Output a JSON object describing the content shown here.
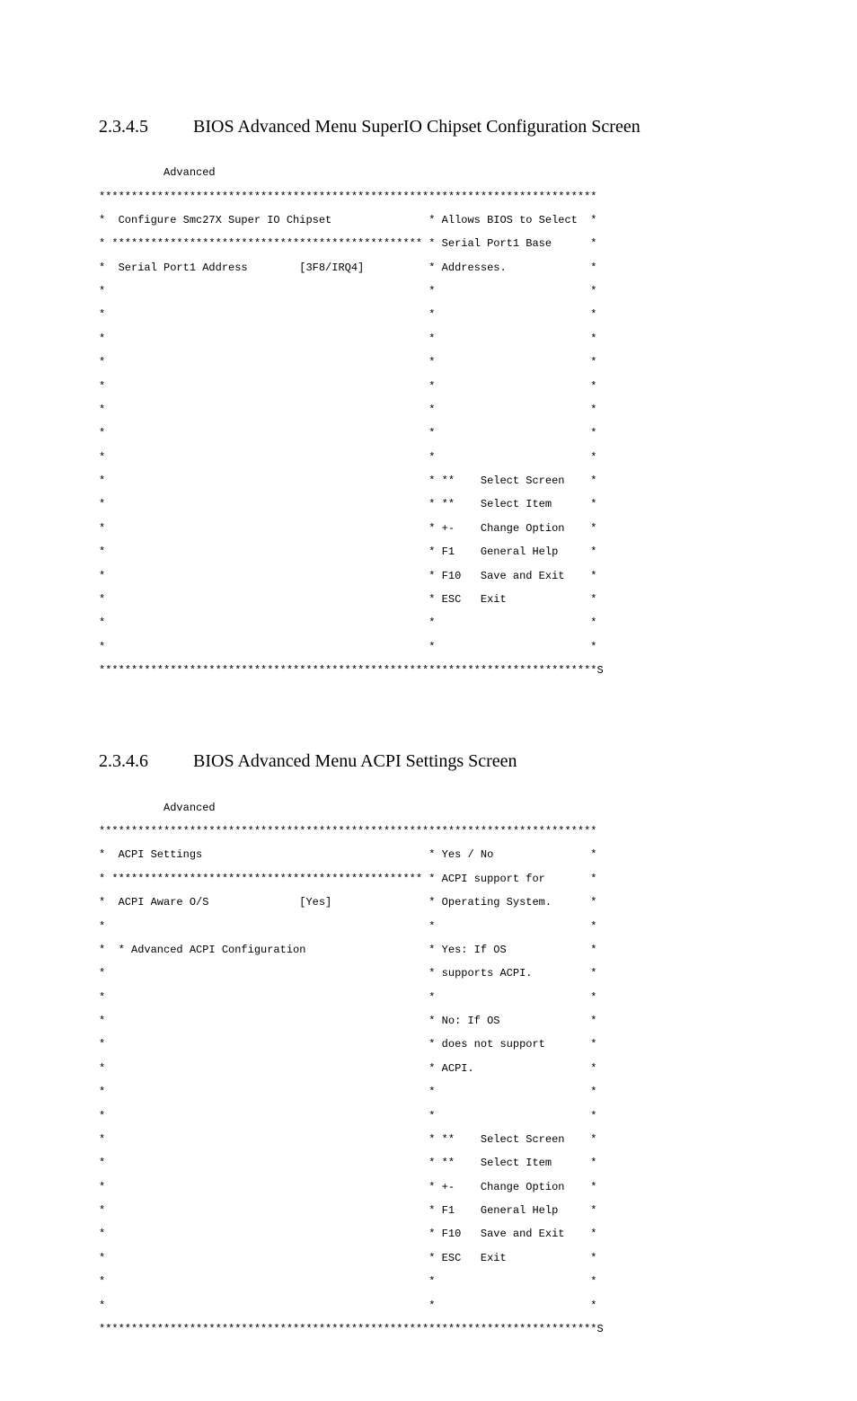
{
  "section1": {
    "number": "2.3.4.5",
    "title": "BIOS Advanced Menu SuperIO Chipset Configuration Screen",
    "tab": "          Advanced",
    "border_top": "*****************************************************************************",
    "header_line": "*  Configure Smc27X Super IO Chipset               * Allows BIOS to Select  *",
    "divider_line": "* ************************************************ * Serial Port1 Base      *",
    "option_line": "*  Serial Port1 Address        [3F8/IRQ4]          * Addresses.             *",
    "blank_line": "*                                                  *                        *",
    "nav_lines": [
      "*                                                  * **    Select Screen    *",
      "*                                                  * **    Select Item      *",
      "*                                                  * +-    Change Option    *",
      "*                                                  * F1    General Help     *",
      "*                                                  * F10   Save and Exit    *",
      "*                                                  * ESC   Exit             *"
    ],
    "border_bottom": "*****************************************************************************S"
  },
  "section2": {
    "number": "2.3.4.6",
    "title": "BIOS Advanced Menu ACPI Settings Screen",
    "tab": "          Advanced",
    "border_top": "*****************************************************************************",
    "lines": [
      "*  ACPI Settings                                   * Yes / No               *",
      "* ************************************************ * ACPI support for       *",
      "*  ACPI Aware O/S              [Yes]               * Operating System.      *",
      "*                                                  *                        *",
      "*  * Advanced ACPI Configuration                   * Yes: If OS             *",
      "*                                                  * supports ACPI.         *",
      "*                                                  *                        *",
      "*                                                  * No: If OS              *",
      "*                                                  * does not support       *",
      "*                                                  * ACPI.                  *",
      "*                                                  *                        *",
      "*                                                  *                        *",
      "*                                                  * **    Select Screen    *",
      "*                                                  * **    Select Item      *",
      "*                                                  * +-    Change Option    *",
      "*                                                  * F1    General Help     *",
      "*                                                  * F10   Save and Exit    *",
      "*                                                  * ESC   Exit             *",
      "*                                                  *                        *",
      "*                                                  *                        *"
    ],
    "border_bottom": "*****************************************************************************S"
  }
}
